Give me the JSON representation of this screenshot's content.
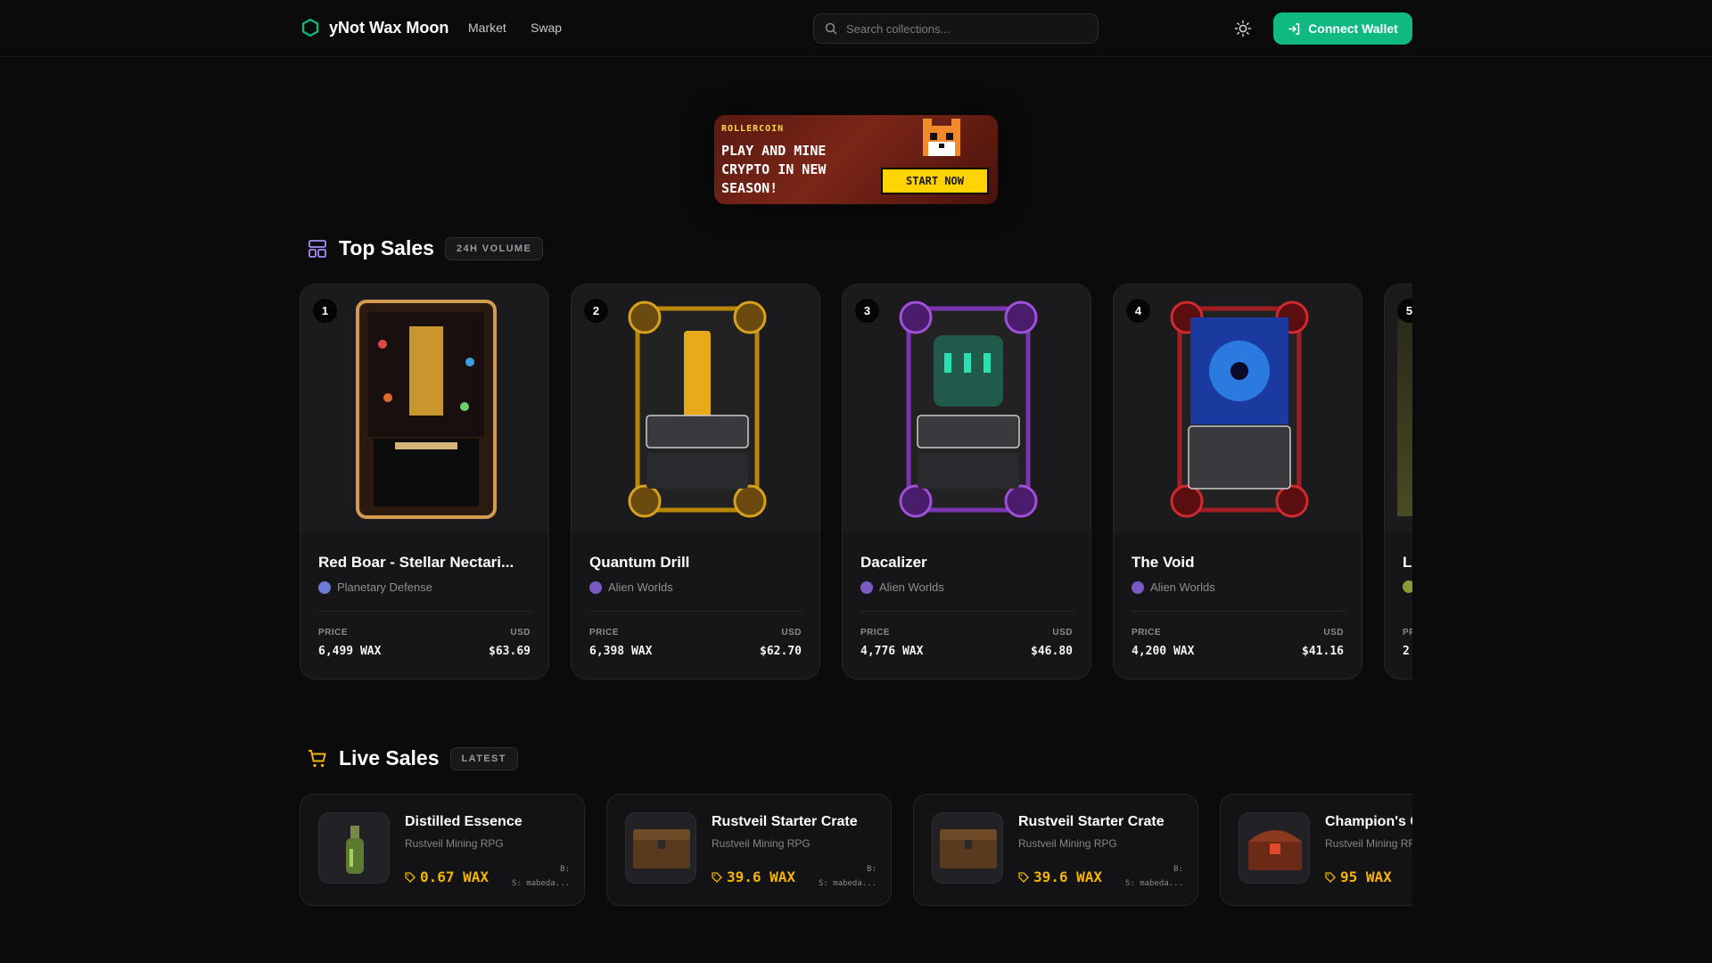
{
  "header": {
    "brand": "yNot Wax Moon",
    "nav": [
      "Market",
      "Swap"
    ],
    "search_placeholder": "Search collections...",
    "connect_label": "Connect Wallet",
    "accent": "#10b981"
  },
  "banner": {
    "brand": "ROLLERCOIN",
    "headline": "PLAY AND MINE CRYPTO IN NEW SEASON!",
    "cta": "START NOW"
  },
  "top_sales": {
    "title": "Top Sales",
    "badge": "24H VOLUME",
    "price_label": "PRICE",
    "usd_label": "USD",
    "items": [
      {
        "rank": "1",
        "name": "Red Boar - Stellar Nectari...",
        "collection": "Planetary Defense",
        "price": "6,499 WAX",
        "usd": "$63.69",
        "color": "#c88a3c"
      },
      {
        "rank": "2",
        "name": "Quantum Drill",
        "collection": "Alien Worlds",
        "price": "6,398 WAX",
        "usd": "$62.70",
        "color": "#d8a21c"
      },
      {
        "rank": "3",
        "name": "Dacalizer",
        "collection": "Alien Worlds",
        "price": "4,776 WAX",
        "usd": "$46.80",
        "color": "#8a3fc4"
      },
      {
        "rank": "4",
        "name": "The Void",
        "collection": "Alien Worlds",
        "price": "4,200 WAX",
        "usd": "$41.16",
        "color": "#c0262a"
      },
      {
        "rank": "5",
        "name": "L",
        "collection": "",
        "price": "2",
        "usd": "",
        "color": "#4a4a2a"
      }
    ]
  },
  "live_sales": {
    "title": "Live Sales",
    "badge": "LATEST",
    "items": [
      {
        "name": "Distilled Essence",
        "collection": "Rustveil Mining RPG",
        "price": "0.67 WAX",
        "buyer": "B:",
        "seller": "S: mabeda..."
      },
      {
        "name": "Rustveil Starter Crate",
        "collection": "Rustveil Mining RPG",
        "price": "39.6 WAX",
        "buyer": "B:",
        "seller": "S: mabeda..."
      },
      {
        "name": "Rustveil Starter Crate",
        "collection": "Rustveil Mining RPG",
        "price": "39.6 WAX",
        "buyer": "B:",
        "seller": "S: mabeda..."
      },
      {
        "name": "Champion's C",
        "collection": "Rustveil Mining RF",
        "price": "95 WAX",
        "buyer": "",
        "seller": ""
      }
    ]
  }
}
